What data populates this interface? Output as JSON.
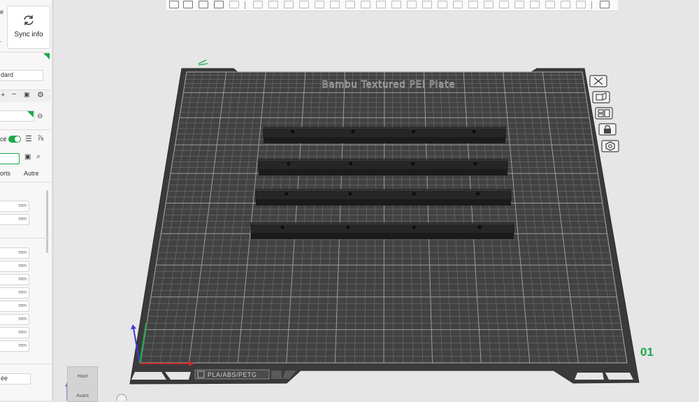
{
  "left_panel": {
    "sync_label": "Sync info",
    "preset_value": "dard",
    "toggle_label": "cé",
    "tab_supports": "orts",
    "tab_other": "Autre",
    "unit": "mm",
    "bottom_value": "ée"
  },
  "plate": {
    "name": "Bambu Textured PEI Plate",
    "filament_label": "PLA/ABS/PETG",
    "number": "01"
  },
  "view_cube": {
    "top": "Haut",
    "front": "Avant"
  },
  "colors": {
    "accent": "#1aa84a",
    "plate": "#3a3a3a",
    "grid": "#8a8a8a",
    "rail": "#1e1e1e"
  },
  "icons": [
    "refresh-icon",
    "plus-icon",
    "minus-icon",
    "gear-icon",
    "save-icon",
    "search-icon",
    "list-icon",
    "close-icon",
    "arrange-icon",
    "lock-icon",
    "settings-icon"
  ]
}
